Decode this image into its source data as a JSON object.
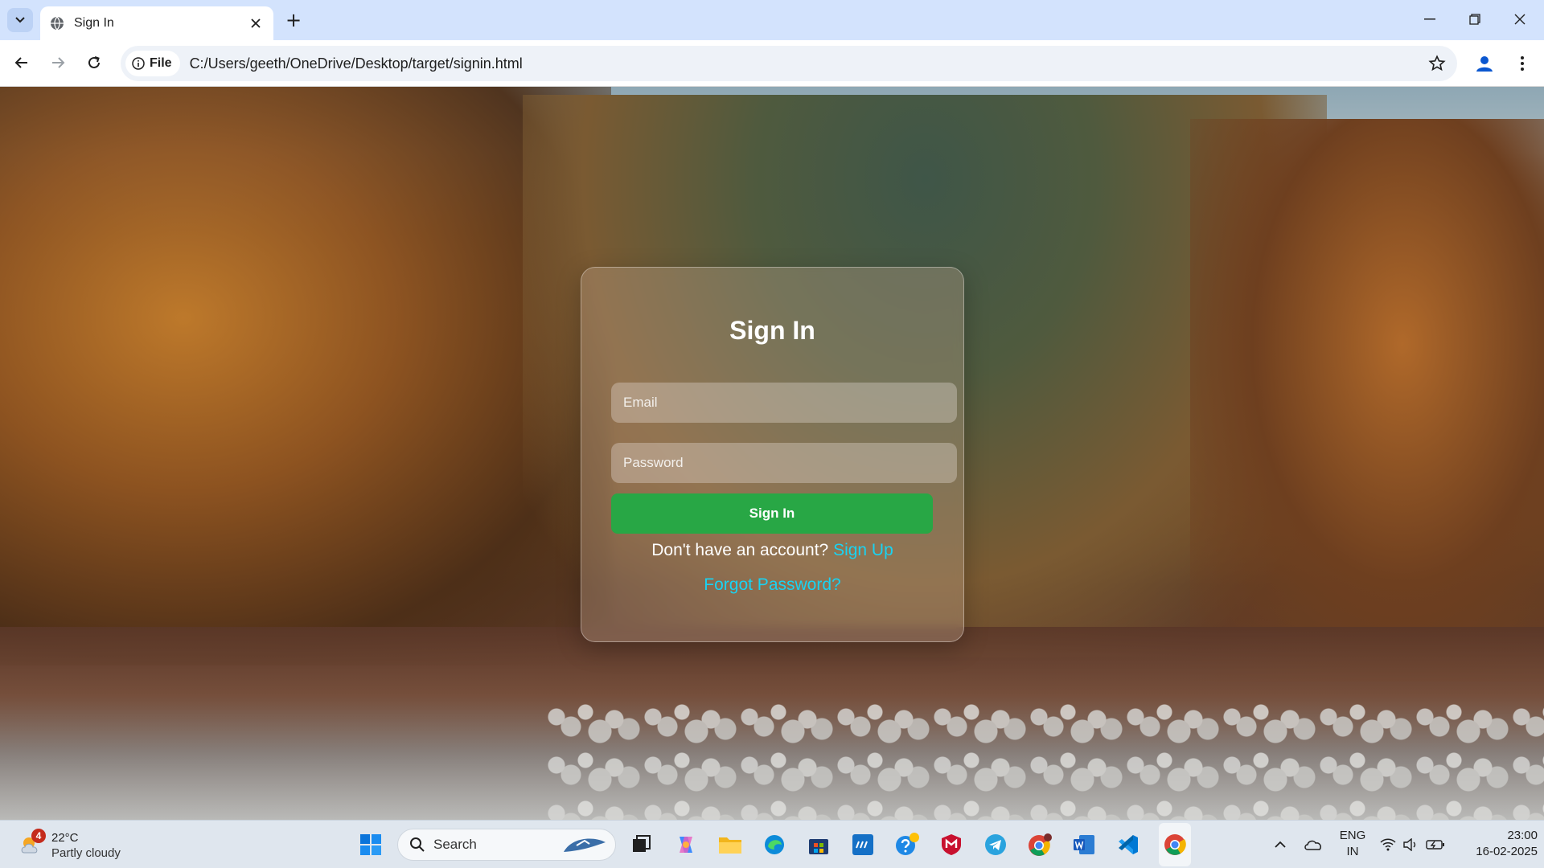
{
  "browser": {
    "tab_title": "Sign In",
    "new_tab_symbol": "+",
    "chip_label": "File",
    "url": "C:/Users/geeth/OneDrive/Desktop/target/signin.html"
  },
  "signin": {
    "title": "Sign In",
    "email_placeholder": "Email",
    "password_placeholder": "Password",
    "button_label": "Sign In",
    "no_account_text": "Don't have an account?",
    "signup_link": "Sign Up",
    "forgot_link": "Forgot Password?"
  },
  "taskbar": {
    "weather_badge": "4",
    "temperature": "22°C",
    "condition": "Partly cloudy",
    "search_label": "Search",
    "lang_top": "ENG",
    "lang_bottom": "IN",
    "time": "23:00",
    "date": "16-02-2025"
  },
  "colors": {
    "tabbar": "#d3e3fd",
    "signin_button": "#28a745",
    "link": "#19d3f2"
  },
  "icons": [
    "tab-search-icon",
    "globe-icon",
    "close-icon",
    "minimize-icon",
    "restore-icon",
    "back-icon",
    "forward-icon",
    "reload-icon",
    "info-icon",
    "star-icon",
    "profile-icon",
    "kebab-menu-icon",
    "windows-start-icon",
    "search-icon",
    "task-view-icon",
    "copilot-icon",
    "file-explorer-icon",
    "edge-icon",
    "store-icon",
    "myhp-icon",
    "help-icon",
    "mcafee-icon",
    "telegram-icon",
    "chrome-icon",
    "word-icon",
    "vscode-icon",
    "chevron-up-icon",
    "onedrive-icon",
    "wifi-icon",
    "volume-icon",
    "battery-icon"
  ]
}
